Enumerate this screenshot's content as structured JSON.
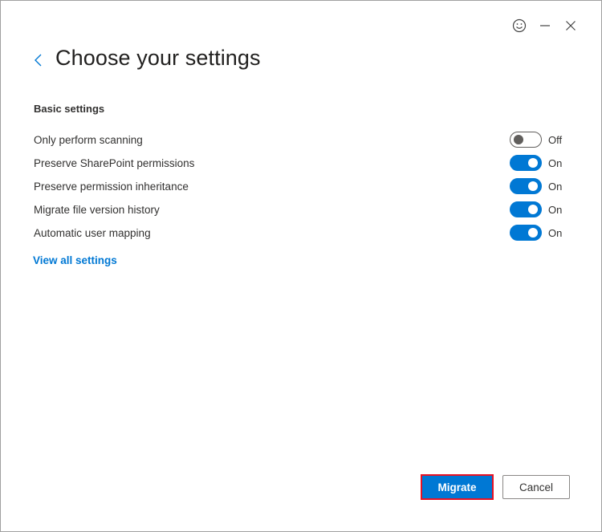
{
  "header": {
    "title": "Choose your settings",
    "icons": [
      "feedback-smiley-icon",
      "minimize-icon",
      "close-icon"
    ]
  },
  "section": {
    "title": "Basic settings"
  },
  "settings": [
    {
      "label": "Only perform scanning",
      "state": "Off",
      "on": false
    },
    {
      "label": "Preserve SharePoint permissions",
      "state": "On",
      "on": true
    },
    {
      "label": "Preserve permission inheritance",
      "state": "On",
      "on": true
    },
    {
      "label": "Migrate file version history",
      "state": "On",
      "on": true
    },
    {
      "label": "Automatic user mapping",
      "state": "On",
      "on": true
    }
  ],
  "links": {
    "view_all": "View all settings"
  },
  "footer": {
    "primary_label": "Migrate",
    "secondary_label": "Cancel"
  },
  "colors": {
    "accent": "#0078d4",
    "highlight_border": "#e81123"
  }
}
